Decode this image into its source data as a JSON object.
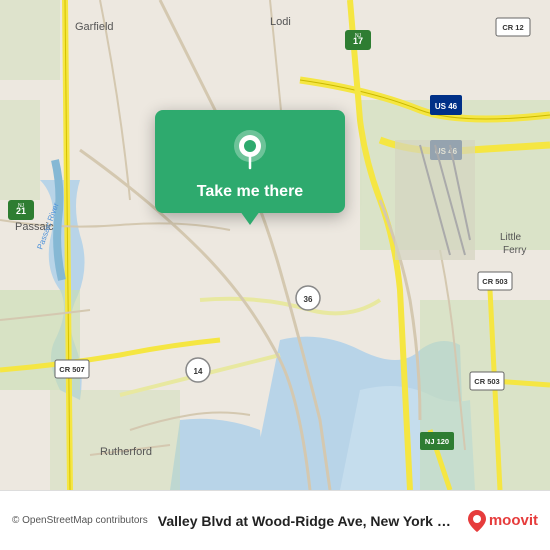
{
  "map": {
    "background_color": "#e4ddd4"
  },
  "popup": {
    "label": "Take me there",
    "background_color": "#2eaa6e"
  },
  "bottom_bar": {
    "osm_credit": "© OpenStreetMap contributors",
    "location_name": "Valley Blvd at Wood-Ridge Ave, New York City",
    "moovit_text": "moovit"
  }
}
